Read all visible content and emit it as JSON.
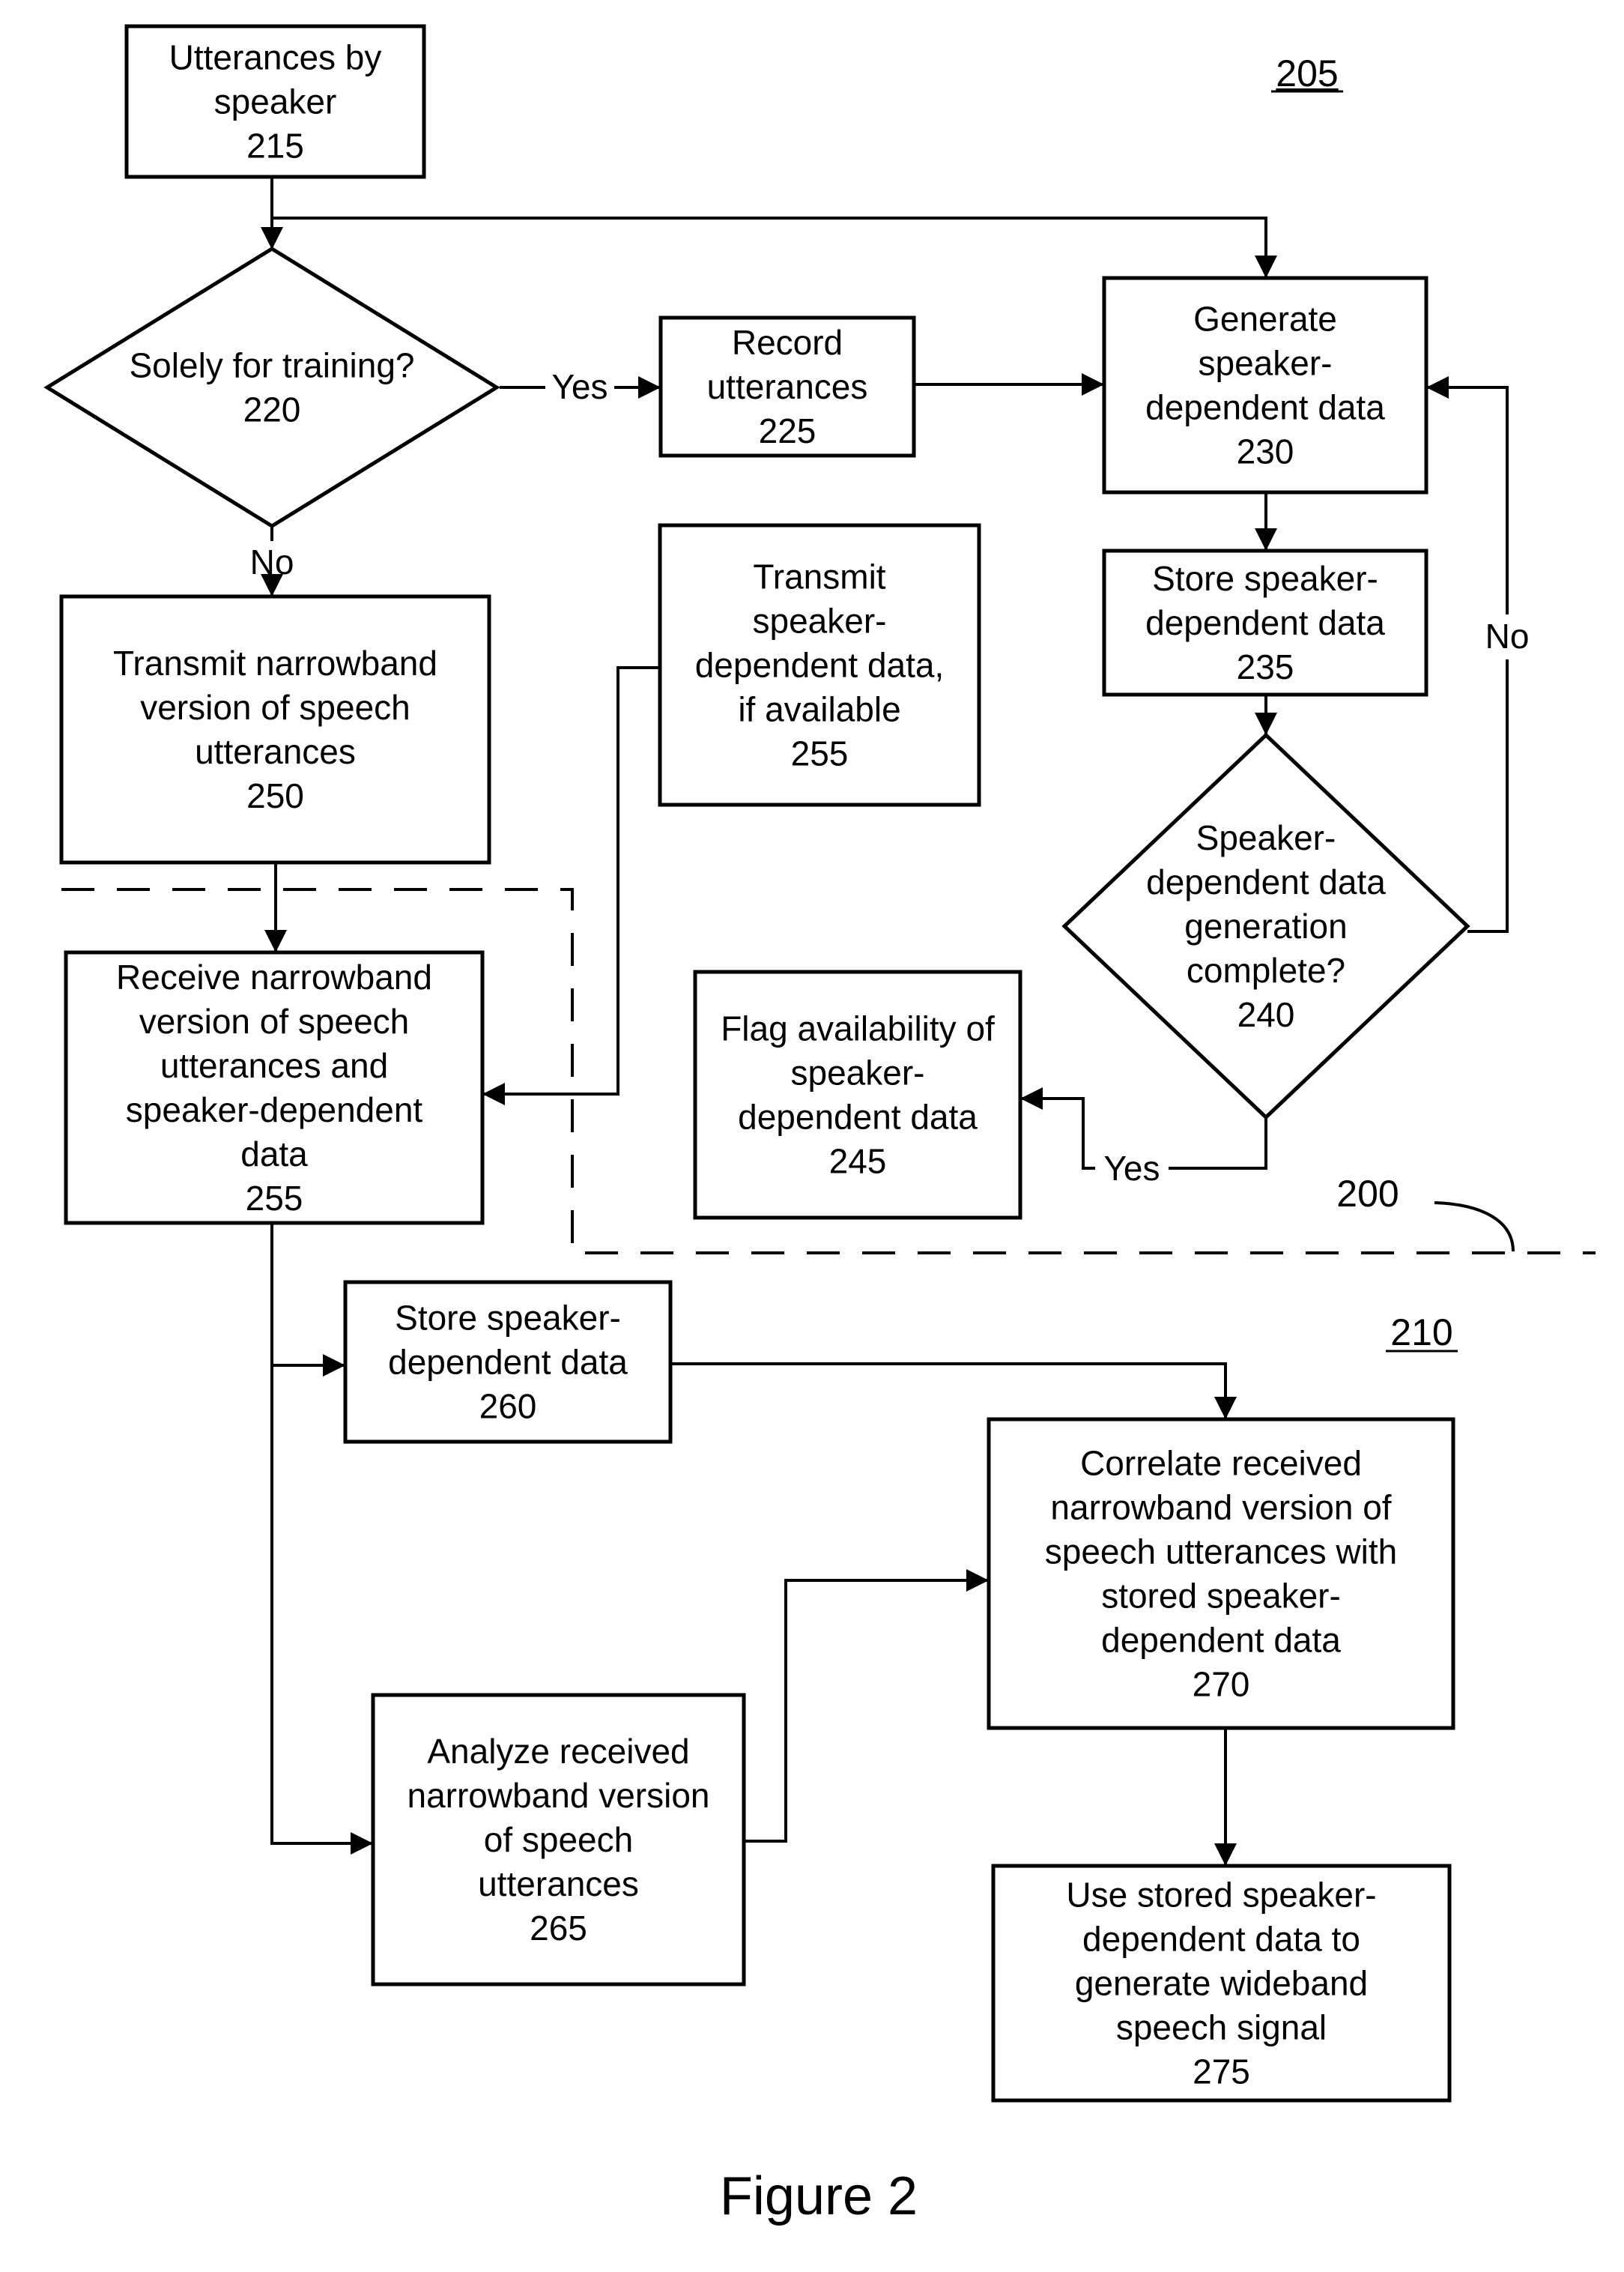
{
  "figure": {
    "caption": "Figure 2",
    "region_labels": {
      "top": "205",
      "bottom": "210",
      "boundary": "200"
    }
  },
  "nodes": {
    "n215": {
      "type": "process",
      "lines": [
        "Utterances by",
        "speaker",
        "215"
      ]
    },
    "n220": {
      "type": "decision",
      "lines": [
        "Solely for training?",
        "220"
      ]
    },
    "n225": {
      "type": "process",
      "lines": [
        "Record",
        "utterances",
        "225"
      ]
    },
    "n230": {
      "type": "process",
      "lines": [
        "Generate",
        "speaker-",
        "dependent data",
        "230"
      ]
    },
    "n235": {
      "type": "process",
      "lines": [
        "Store speaker-",
        "dependent data",
        "235"
      ]
    },
    "n240": {
      "type": "decision",
      "lines": [
        "Speaker-",
        "dependent data",
        "generation",
        "complete?",
        "240"
      ]
    },
    "n245": {
      "type": "process",
      "lines": [
        "Flag availability of",
        "speaker-",
        "dependent data",
        "245"
      ]
    },
    "n250": {
      "type": "process",
      "lines": [
        "Transmit narrowband",
        "version of speech",
        "utterances",
        "250"
      ]
    },
    "n255t": {
      "type": "process",
      "lines": [
        "Transmit",
        "speaker-",
        "dependent data,",
        "if available",
        "255"
      ]
    },
    "n255r": {
      "type": "process",
      "lines": [
        "Receive narrowband",
        "version of speech",
        "utterances and",
        "speaker-dependent",
        "data",
        "255"
      ]
    },
    "n260": {
      "type": "process",
      "lines": [
        "Store speaker-",
        "dependent data",
        "260"
      ]
    },
    "n265": {
      "type": "process",
      "lines": [
        "Analyze received",
        "narrowband version",
        "of speech",
        "utterances",
        "265"
      ]
    },
    "n270": {
      "type": "process",
      "lines": [
        "Correlate received",
        "narrowband version of",
        "speech utterances with",
        "stored speaker-",
        "dependent data",
        "270"
      ]
    },
    "n275": {
      "type": "process",
      "lines": [
        "Use stored speaker-",
        "dependent data to",
        "generate wideband",
        "speech signal",
        "275"
      ]
    }
  },
  "edges": [
    {
      "from": "n215",
      "to": "n220",
      "label": ""
    },
    {
      "from": "n215",
      "to": "n230",
      "label": ""
    },
    {
      "from": "n220",
      "to": "n225",
      "label": "Yes"
    },
    {
      "from": "n220",
      "to": "n250",
      "label": "No"
    },
    {
      "from": "n225",
      "to": "n230",
      "label": ""
    },
    {
      "from": "n230",
      "to": "n235",
      "label": ""
    },
    {
      "from": "n235",
      "to": "n240",
      "label": ""
    },
    {
      "from": "n240",
      "to": "n230",
      "label": "No"
    },
    {
      "from": "n240",
      "to": "n245",
      "label": "Yes"
    },
    {
      "from": "n250",
      "to": "n255r",
      "label": ""
    },
    {
      "from": "n255t",
      "to": "n255r",
      "label": ""
    },
    {
      "from": "n255r",
      "to": "n260",
      "label": ""
    },
    {
      "from": "n255r",
      "to": "n265",
      "label": ""
    },
    {
      "from": "n260",
      "to": "n270",
      "label": ""
    },
    {
      "from": "n265",
      "to": "n270",
      "label": ""
    },
    {
      "from": "n270",
      "to": "n275",
      "label": ""
    }
  ],
  "edge_labels": {
    "yes": "Yes",
    "no": "No"
  }
}
